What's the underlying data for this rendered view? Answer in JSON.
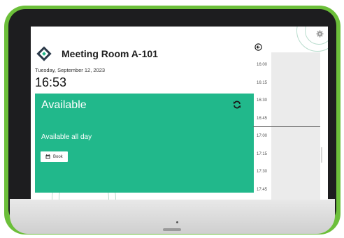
{
  "room": {
    "name": "Meeting Room A-101"
  },
  "clock": {
    "date": "Tuesday, September 12, 2023",
    "time": "16:53"
  },
  "status": {
    "title": "Available",
    "subtitle": "Available all day",
    "book_label": "Book",
    "color": "#21b88b"
  },
  "timeline": {
    "slots": [
      "16:00",
      "16:15",
      "16:30",
      "16:45",
      "17:00",
      "17:15",
      "17:30",
      "17:45"
    ]
  },
  "theme": {
    "frame_color": "#6cbf3a",
    "bezel_color": "#1d1d1f",
    "accent": "#21b88b"
  },
  "icons": {
    "room": "diamond-logo-icon",
    "refresh": "refresh-icon",
    "back": "back-arrow-icon",
    "settings": "gear-icon",
    "book": "calendar-icon"
  }
}
